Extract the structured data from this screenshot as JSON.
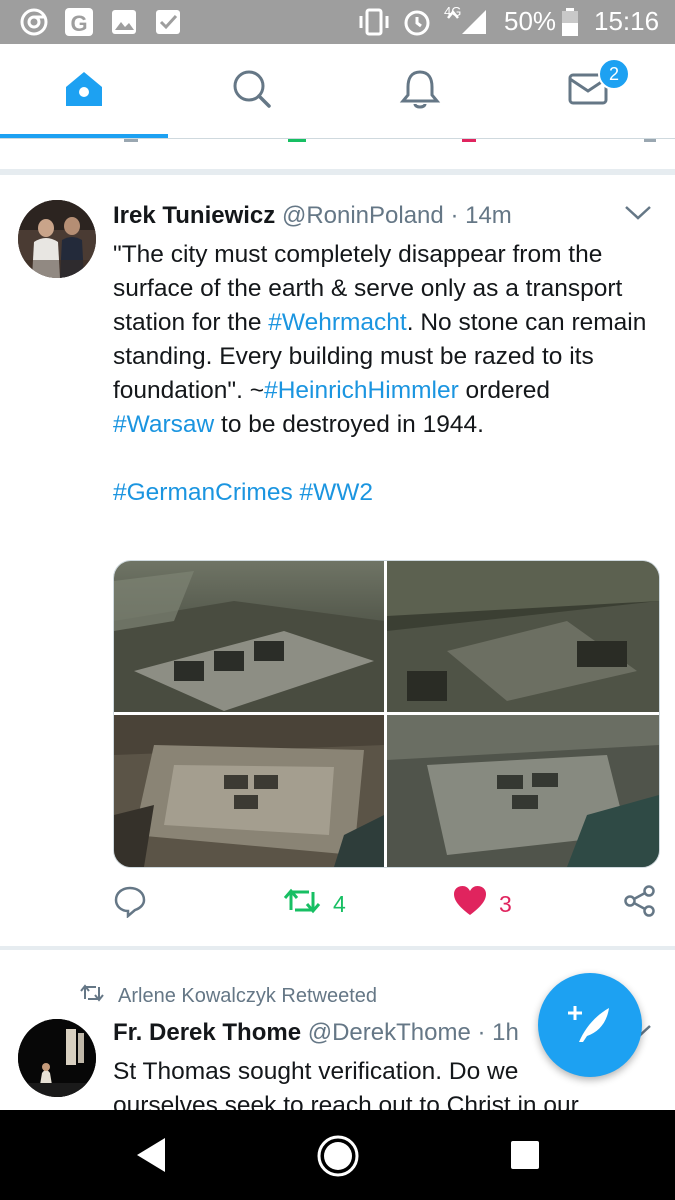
{
  "status_bar": {
    "network": "4G",
    "battery": "50%",
    "time": "15:16",
    "left_icons": [
      "chrome-icon",
      "google-icon",
      "image-icon",
      "checkbox-icon"
    ],
    "right_icons": [
      "vibrate-icon",
      "alarm-icon",
      "signal-icon",
      "battery-icon"
    ]
  },
  "nav": {
    "items": [
      {
        "name": "home",
        "icon": "home-icon",
        "active": true
      },
      {
        "name": "search",
        "icon": "search-icon"
      },
      {
        "name": "notifications",
        "icon": "bell-icon"
      },
      {
        "name": "messages",
        "icon": "mail-icon",
        "badge": "2"
      }
    ],
    "accent": "#1da1f2"
  },
  "tweet": {
    "name": "Irek Tuniewicz",
    "handle": "@RoninPoland",
    "dot": "·",
    "time": "14m",
    "text": {
      "p1": "\"The city must completely disappear from the surface of the earth & serve only as a transport station for the ",
      "tag_wehrmacht": "#Wehrmacht",
      "p2": ". No stone can remain standing. Every building must be razed to its foundation\". ~",
      "tag_himmler": "#HeinrichHimmler",
      "p3": " ordered ",
      "tag_warsaw": "#Warsaw",
      "p4": " to be destroyed in 1944.",
      "tag_germancrimes": "#GermanCrimes",
      "space": " ",
      "tag_ww2": "#WW2"
    },
    "photos": 4,
    "retweets": "4",
    "likes": "3",
    "retweet_color": "#17bf63",
    "like_color": "#e0245e"
  },
  "next_tweet": {
    "retweeted_by": "Arlene Kowalczyk Retweeted",
    "name": "Fr. Derek Thome",
    "handle": "@DerekThome",
    "dot": "·",
    "time": "1h",
    "text_line1": "St Thomas sought verification. Do we",
    "text_line2": "ourselves seek to reach out to Christ in our"
  }
}
